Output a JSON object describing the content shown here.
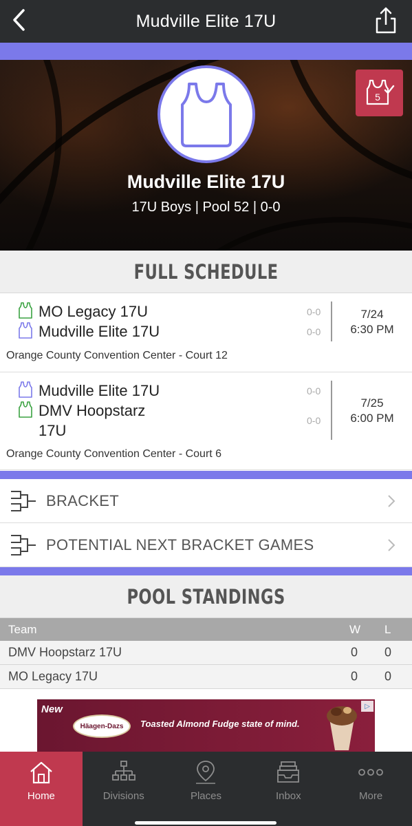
{
  "header": {
    "title": "Mudville Elite 17U",
    "back_icon": "chevron-left-icon",
    "share_icon": "share-icon"
  },
  "colors": {
    "accent": "#7b79ea",
    "brand_red": "#c0394f",
    "nav_dark": "#2b2d2f",
    "home_jersey": "#7b79ea",
    "opponent_jersey": "#3aa241"
  },
  "hero": {
    "team_name": "Mudville Elite 17U",
    "subtitle": "17U Boys | Pool 52 | 0-0",
    "logo_icon": "jersey-icon",
    "badge_icon": "jersey-check-icon",
    "badge_number": "5"
  },
  "schedule": {
    "header": "FULL SCHEDULE",
    "games": [
      {
        "team1": "MO Legacy 17U",
        "team1_score": "0-0",
        "team2": "Mudville Elite 17U",
        "team2_score": "0-0",
        "date": "7/24",
        "time": "6:30 PM",
        "venue": "Orange County Convention Center - Court 12"
      },
      {
        "team1": "Mudville Elite 17U",
        "team1_score": "0-0",
        "team2_line1": "DMV Hoopstarz",
        "team2_line2": "17U",
        "team2_score": "0-0",
        "date": "7/25",
        "time": "6:00 PM",
        "venue": "Orange County Convention Center - Court 6"
      }
    ]
  },
  "links": {
    "bracket": "BRACKET",
    "potential": "POTENTIAL NEXT BRACKET GAMES"
  },
  "standings": {
    "header": "POOL STANDINGS",
    "columns": {
      "team": "Team",
      "w": "W",
      "l": "L"
    },
    "rows": [
      {
        "team": "DMV Hoopstarz 17U",
        "w": "0",
        "l": "0"
      },
      {
        "team": "MO Legacy 17U",
        "w": "0",
        "l": "0"
      }
    ]
  },
  "ad": {
    "new_label": "New",
    "brand": "Häagen-Dazs",
    "tagline": "Toasted Almond Fudge state of mind.",
    "adchoices_icon": "adchoices-icon"
  },
  "tabs": [
    {
      "label": "Home",
      "icon": "home-icon",
      "active": true
    },
    {
      "label": "Divisions",
      "icon": "hierarchy-icon",
      "active": false
    },
    {
      "label": "Places",
      "icon": "map-pin-icon",
      "active": false
    },
    {
      "label": "Inbox",
      "icon": "inbox-icon",
      "active": false
    },
    {
      "label": "More",
      "icon": "more-icon",
      "active": false
    }
  ]
}
